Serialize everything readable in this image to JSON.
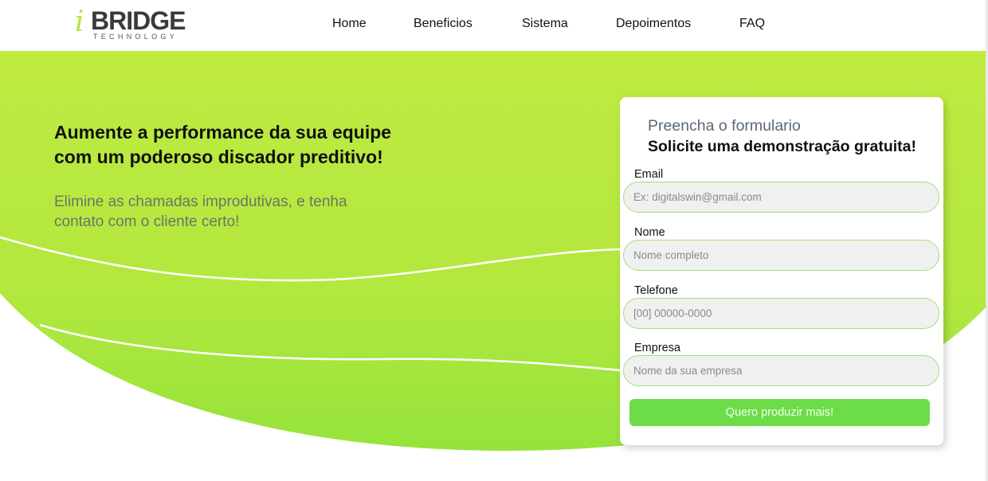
{
  "logo": {
    "mark": "i",
    "name": "BRIDGE",
    "tagline": "TECHNOLOGY"
  },
  "nav": {
    "items": [
      "Home",
      "Beneficios",
      "Sistema",
      "Depoimentos",
      "FAQ"
    ]
  },
  "hero": {
    "title": "Aumente a performance da sua equipe com um poderoso discador preditivo!",
    "subtitle": "Elimine as chamadas improdutivas, e tenha contato com o cliente certo!"
  },
  "form": {
    "heading": "Preencha o formulario",
    "subheading": "Solicite uma demonstração gratuita!",
    "fields": {
      "email": {
        "label": "Email",
        "placeholder": "Ex: digitalswin@gmail.com",
        "value": ""
      },
      "nome": {
        "label": "Nome",
        "placeholder": "Nome completo",
        "value": ""
      },
      "telefone": {
        "label": "Telefone",
        "placeholder": "[00] 00000-0000",
        "value": ""
      },
      "empresa": {
        "label": "Empresa",
        "placeholder": "Nome da sua empresa",
        "value": ""
      }
    },
    "submit_label": "Quero produzir mais!"
  },
  "colors": {
    "hero_green": "#bde93f",
    "accent_green": "#6cdc48",
    "input_border": "#9fe27a"
  }
}
